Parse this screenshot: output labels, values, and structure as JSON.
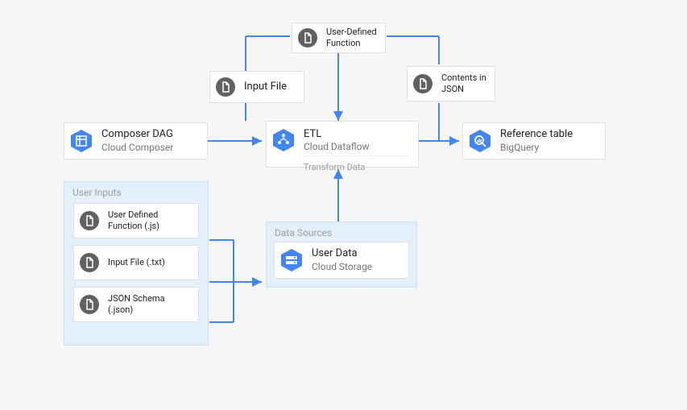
{
  "nodes": {
    "udf_top": {
      "title": "User-Defined Function"
    },
    "input_file": {
      "title": "Input File"
    },
    "contents_json": {
      "title": "Contents in JSON"
    },
    "composer": {
      "title": "Composer DAG",
      "subtitle": "Cloud Composer"
    },
    "etl": {
      "title": "ETL",
      "subtitle": "Cloud Dataflow",
      "caption": "Transform Data"
    },
    "reference": {
      "title": "Reference table",
      "subtitle": "BigQuery"
    },
    "user_data": {
      "title": "User Data",
      "subtitle": "Cloud Storage"
    }
  },
  "groups": {
    "user_inputs": {
      "title": "User Inputs",
      "items": [
        {
          "title": "User Defined Function (.js)"
        },
        {
          "title": "Input File (.txt)"
        },
        {
          "title": "JSON Schema (.json)"
        }
      ]
    },
    "data_sources": {
      "title": "Data Sources"
    }
  },
  "colors": {
    "arrow": "#4285f4",
    "hex": "#4285f4",
    "docIcon": "#616161",
    "groupBg": "#e3f0fa"
  }
}
